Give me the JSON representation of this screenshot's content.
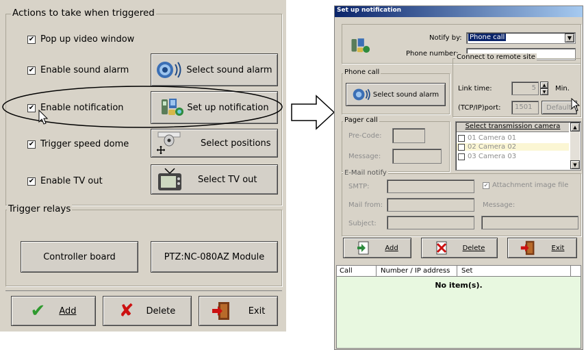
{
  "left": {
    "actions_group_label": "Actions to take when triggered",
    "options": [
      {
        "label": "Pop up video window",
        "checked": true
      },
      {
        "label": "Enable sound alarm",
        "checked": true
      },
      {
        "label": "Enable notification",
        "checked": true
      },
      {
        "label": "Trigger speed dome",
        "checked": true
      },
      {
        "label": "Enable TV out",
        "checked": true
      }
    ],
    "side_buttons": {
      "sound": "Select sound alarm",
      "notification": "Set up notification",
      "positions": "Select positions",
      "tvout": "Select TV out"
    },
    "relays_group_label": "Trigger relays",
    "relay_buttons": {
      "controller": "Controller board",
      "ptz": "PTZ:NC-080AZ Module"
    },
    "bottom_buttons": {
      "add": "Add",
      "delete": "Delete",
      "exit": "Exit"
    }
  },
  "dialog": {
    "title": "Set up notification",
    "notify_by_label": "Notify by:",
    "notify_by_value": "Phone call",
    "phone_number_label": "Phone number:",
    "phone_number_value": "",
    "phone_call_group": "Phone call",
    "select_sound_alarm": "Select sound alarm",
    "remote_group": "Connect to remote site",
    "link_time_label": "Link time:",
    "link_time_value": "5",
    "link_time_unit": "Min.",
    "port_label": "(TCP/IP)port:",
    "port_value": "1501",
    "default_button": "Default",
    "pager_group": "Pager call",
    "pre_code_label": "Pre-Code:",
    "message_label": "Message:",
    "camera_list_header": "Select transmission camera",
    "cameras": [
      "01 Camera 01",
      "02 Camera 02",
      "03 Camera 03"
    ],
    "email_group": "E-Mail notify",
    "smtp_label": "SMTP:",
    "attachment_label": "Attachment image file",
    "mail_from_label": "Mail from:",
    "email_message_label": "Message:",
    "subject_label": "Subject:",
    "buttons": {
      "add": "Add",
      "delete": "Delete",
      "exit": "Exit"
    },
    "table_headers": [
      "Call",
      "Number / IP address",
      "Set"
    ],
    "table_empty": "No item(s).",
    "table_bg": "#e8f8e0"
  }
}
